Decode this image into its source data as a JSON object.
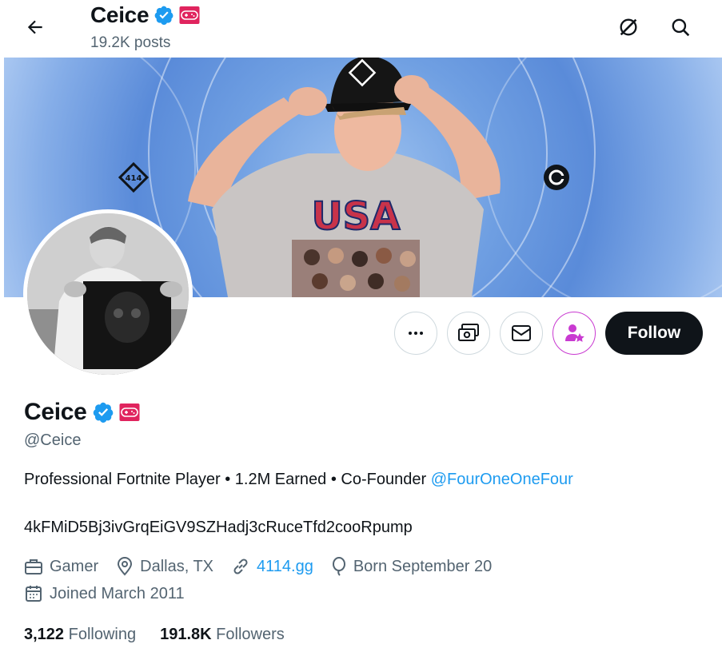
{
  "header": {
    "name": "Ceice",
    "posts": "19.2K posts"
  },
  "profile": {
    "name": "Ceice",
    "handle": "@Ceice",
    "bio_text": "Professional Fortnite Player • 1.2M Earned • Co-Founder ",
    "bio_link": "@FourOneOneFour",
    "bio_line2": "4kFMiD5Bj3ivGrqEiGV9SZHadj3cRuceTfd2cooRpump"
  },
  "meta": {
    "category": "Gamer",
    "location": "Dallas, TX",
    "website": "4114.gg",
    "birthday": "Born September 20",
    "joined": "Joined March 2011"
  },
  "stats": {
    "following_count": "3,122",
    "following_label": "Following",
    "followers_count": "191.8K",
    "followers_label": "Followers"
  },
  "actions": {
    "follow_label": "Follow"
  },
  "banner": {
    "shirt_text": "USA"
  },
  "colors": {
    "verified": "#1d9bf0",
    "affiliate_badge": "#e0245e",
    "subscribe_accent": "#c93ad1",
    "follow_bg": "#0f1419",
    "link": "#1d9bf0"
  },
  "icons": [
    "back-arrow-icon",
    "grok-icon",
    "search-icon",
    "verified-icon",
    "gamepad-badge-icon",
    "more-icon",
    "tip-icon",
    "message-icon",
    "subscribe-icon",
    "briefcase-icon",
    "location-icon",
    "link-icon",
    "balloon-icon",
    "calendar-icon"
  ]
}
